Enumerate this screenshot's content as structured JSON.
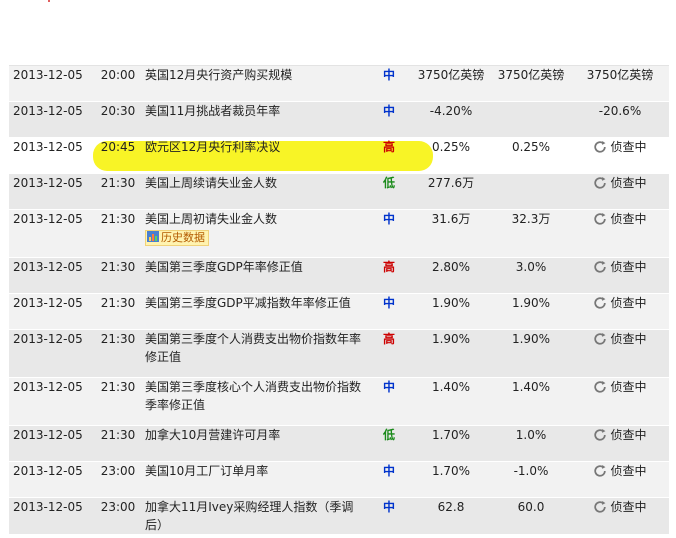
{
  "table": {
    "rows": [
      {
        "date": "2013-12-05",
        "time": "20:00",
        "event": "英国12月央行资产购买规模",
        "importance": "中",
        "level": "mid",
        "previous": "3750亿英镑",
        "forecast": "3750亿英镑",
        "actual": "3750亿英镑",
        "pending": false,
        "history": false
      },
      {
        "date": "2013-12-05",
        "time": "20:30",
        "event": "美国11月挑战者裁员年率",
        "importance": "中",
        "level": "mid",
        "previous": "-4.20%",
        "forecast": "",
        "actual": "-20.6%",
        "pending": false,
        "history": false
      },
      {
        "date": "2013-12-05",
        "time": "20:45",
        "event": "欧元区12月央行利率决议",
        "importance": "高",
        "level": "high",
        "previous": "0.25%",
        "forecast": "0.25%",
        "actual": "",
        "pending": true,
        "history": false,
        "highlighted": true
      },
      {
        "date": "2013-12-05",
        "time": "21:30",
        "event": "美国上周续请失业金人数",
        "importance": "低",
        "level": "low",
        "previous": "277.6万",
        "forecast": "",
        "actual": "",
        "pending": true,
        "history": false
      },
      {
        "date": "2013-12-05",
        "time": "21:30",
        "event": "美国上周初请失业金人数",
        "importance": "中",
        "level": "mid",
        "previous": "31.6万",
        "forecast": "32.3万",
        "actual": "",
        "pending": true,
        "history": true
      },
      {
        "date": "2013-12-05",
        "time": "21:30",
        "event": "美国第三季度GDP年率修正值",
        "importance": "高",
        "level": "high",
        "previous": "2.80%",
        "forecast": "3.0%",
        "actual": "",
        "pending": true,
        "history": false
      },
      {
        "date": "2013-12-05",
        "time": "21:30",
        "event": "美国第三季度GDP平减指数年率修正值",
        "importance": "中",
        "level": "mid",
        "previous": "1.90%",
        "forecast": "1.90%",
        "actual": "",
        "pending": true,
        "history": false
      },
      {
        "date": "2013-12-05",
        "time": "21:30",
        "event": "美国第三季度个人消费支出物价指数年率修正值",
        "importance": "高",
        "level": "high",
        "previous": "1.90%",
        "forecast": "1.90%",
        "actual": "",
        "pending": true,
        "history": false
      },
      {
        "date": "2013-12-05",
        "time": "21:30",
        "event": "美国第三季度核心个人消费支出物价指数季率修正值",
        "importance": "中",
        "level": "mid",
        "previous": "1.40%",
        "forecast": "1.40%",
        "actual": "",
        "pending": true,
        "history": false
      },
      {
        "date": "2013-12-05",
        "time": "21:30",
        "event": "加拿大10月营建许可月率",
        "importance": "低",
        "level": "low",
        "previous": "1.70%",
        "forecast": "1.0%",
        "actual": "",
        "pending": true,
        "history": false
      },
      {
        "date": "2013-12-05",
        "time": "23:00",
        "event": "美国10月工厂订单月率",
        "importance": "中",
        "level": "mid",
        "previous": "1.70%",
        "forecast": "-1.0%",
        "actual": "",
        "pending": true,
        "history": false
      },
      {
        "date": "2013-12-05",
        "time": "23:00",
        "event": "加拿大11月Ivey采购经理人指数（季调后）",
        "importance": "中",
        "level": "mid",
        "previous": "62.8",
        "forecast": "60.0",
        "actual": "",
        "pending": true,
        "history": false
      }
    ],
    "pending_label": "侦查中",
    "history_label": "历史数据"
  },
  "colors": {
    "high": "#cc0000",
    "mid": "#0033cc",
    "low": "#1a8a1a",
    "highlight": "#f7f200"
  }
}
